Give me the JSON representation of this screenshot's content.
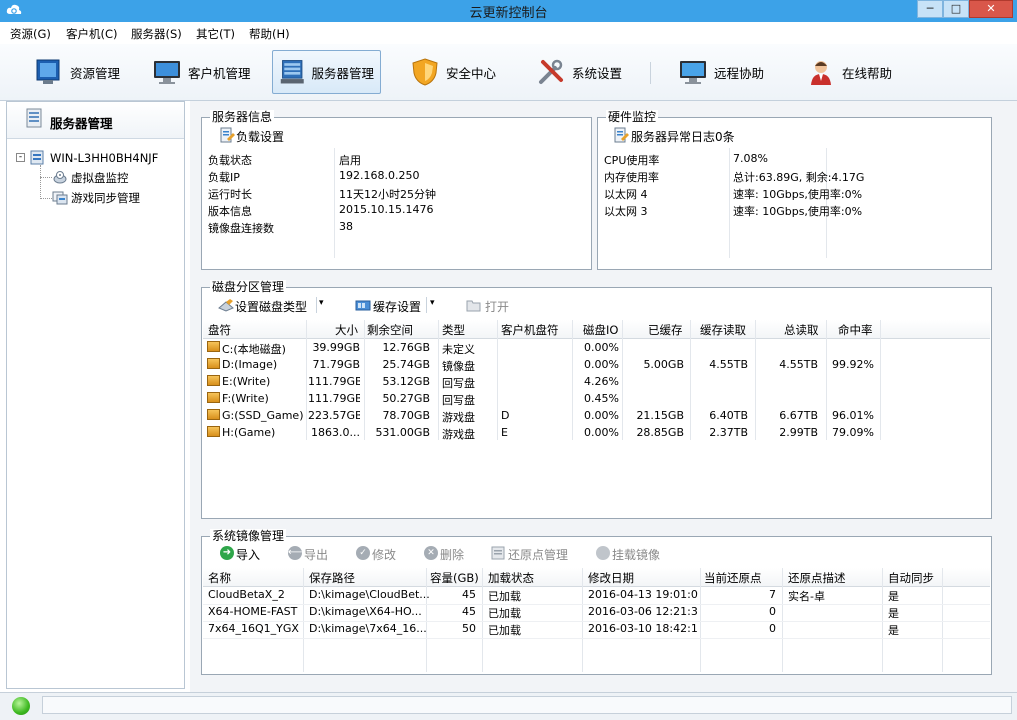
{
  "window": {
    "title": "云更新控制台",
    "controls": {
      "minimize": "─",
      "maximize": "□",
      "close": "✕"
    }
  },
  "menu": [
    "资源(G)",
    "客户机(C)",
    "服务器(S)",
    "其它(T)",
    "帮助(H)"
  ],
  "toolbar": [
    {
      "label": "资源管理",
      "icon": "monitor-blue-icon"
    },
    {
      "label": "客户机管理",
      "icon": "client-monitor-icon"
    },
    {
      "label": "服务器管理",
      "icon": "server-icon",
      "active": true
    },
    {
      "label": "安全中心",
      "icon": "shield-icon"
    },
    {
      "label": "系统设置",
      "icon": "tools-icon"
    },
    {
      "label": "远程协助",
      "icon": "remote-monitor-icon"
    },
    {
      "label": "在线帮助",
      "icon": "support-person-icon"
    }
  ],
  "sidebar": {
    "title": "服务器管理",
    "tree": {
      "root": "WIN-L3HH0BH4NJF",
      "children": [
        "虚拟盘监控",
        "游戏同步管理"
      ]
    }
  },
  "server_info": {
    "title": "服务器信息",
    "action": "负载设置",
    "rows": [
      {
        "label": "负载状态",
        "value": "启用"
      },
      {
        "label": "负载IP",
        "value": "192.168.0.250"
      },
      {
        "label": "运行时长",
        "value": "11天12小时25分钟"
      },
      {
        "label": "版本信息",
        "value": "2015.10.15.1476"
      },
      {
        "label": "镜像盘连接数",
        "value": "38"
      }
    ]
  },
  "hardware": {
    "title": "硬件监控",
    "action": "服务器异常日志0条",
    "rows": [
      {
        "label": "CPU使用率",
        "value": "7.08%"
      },
      {
        "label": "内存使用率",
        "value": "总计:63.89G, 剩余:4.17G"
      },
      {
        "label": "以太网 4",
        "value": "速率: 10Gbps,使用率:0%"
      },
      {
        "label": "以太网 3",
        "value": "速率: 10Gbps,使用率:0%"
      }
    ]
  },
  "disk": {
    "title": "磁盘分区管理",
    "actions": [
      {
        "label": "设置磁盘类型",
        "dropdown": true,
        "disabled": false
      },
      {
        "label": "缓存设置",
        "dropdown": true,
        "disabled": false
      },
      {
        "label": "打开",
        "dropdown": false,
        "disabled": true
      }
    ],
    "columns": [
      "盘符",
      "大小",
      "剩余空间",
      "类型",
      "客户机盘符",
      "磁盘IO",
      "已缓存",
      "缓存读取",
      "总读取",
      "命中率"
    ],
    "rows": [
      [
        "C:(本地磁盘)",
        "39.99GB",
        "12.76GB",
        "未定义",
        "",
        "0.00%",
        "",
        "",
        "",
        ""
      ],
      [
        "D:(Image)",
        "71.79GB",
        "25.74GB",
        "镜像盘",
        "",
        "0.00%",
        "5.00GB",
        "4.55TB",
        "4.55TB",
        "99.92%"
      ],
      [
        "E:(Write)",
        "111.79GB",
        "53.12GB",
        "回写盘",
        "",
        "4.26%",
        "",
        "",
        "",
        ""
      ],
      [
        "F:(Write)",
        "111.79GB",
        "50.27GB",
        "回写盘",
        "",
        "0.45%",
        "",
        "",
        "",
        ""
      ],
      [
        "G:(SSD_Game)",
        "223.57GB",
        "78.70GB",
        "游戏盘",
        "D",
        "0.00%",
        "21.15GB",
        "6.40TB",
        "6.67TB",
        "96.01%"
      ],
      [
        "H:(Game)",
        "1863.0...",
        "531.00GB",
        "游戏盘",
        "E",
        "0.00%",
        "28.85GB",
        "2.37TB",
        "2.99TB",
        "79.09%"
      ]
    ]
  },
  "image": {
    "title": "系统镜像管理",
    "actions": [
      {
        "label": "导入",
        "disabled": false
      },
      {
        "label": "导出",
        "disabled": true
      },
      {
        "label": "修改",
        "disabled": true
      },
      {
        "label": "删除",
        "disabled": true
      },
      {
        "label": "还原点管理",
        "disabled": true
      },
      {
        "label": "挂载镜像",
        "disabled": true
      }
    ],
    "columns": [
      "名称",
      "保存路径",
      "容量(GB)",
      "加载状态",
      "修改日期",
      "当前还原点",
      "还原点描述",
      "自动同步"
    ],
    "rows": [
      [
        "CloudBetaX_2",
        "D:\\kimage\\CloudBet...",
        "45",
        "已加载",
        "2016-04-13 19:01:07",
        "7",
        "实名-卓",
        "是"
      ],
      [
        "X64-HOME-FAST",
        "D:\\kimage\\X64-HO...",
        "45",
        "已加载",
        "2016-03-06 12:21:39",
        "0",
        "",
        "是"
      ],
      [
        "7x64_16Q1_YGX",
        "D:\\kimage\\7x64_16...",
        "50",
        "已加载",
        "2016-03-10 18:42:19",
        "0",
        "",
        "是"
      ]
    ]
  },
  "colors": {
    "titlebar": "#3ca2e8",
    "close": "#d9574a",
    "status_ok": "#3cb81f"
  }
}
